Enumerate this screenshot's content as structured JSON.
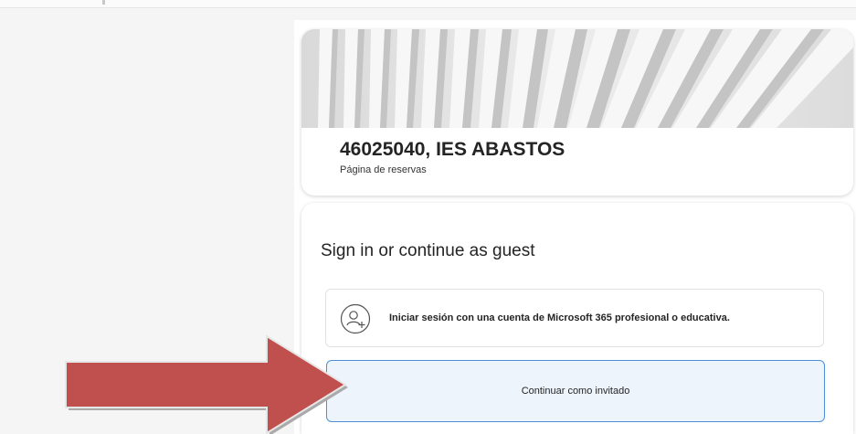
{
  "header": {
    "org_title": "46025040, IES ABASTOS",
    "org_subtitle": "Página de reservas"
  },
  "signin_card": {
    "heading": "Sign in or continue as guest",
    "signin_option_label": "Iniciar sesión con una cuenta de Microsoft 365 profesional o educativa.",
    "guest_option_label": "Continuar como invitado"
  },
  "icons": {
    "signin_option": "person-add-icon",
    "annotation": "red-arrow-icon"
  },
  "colors": {
    "accent_border": "#4f8fd6",
    "guest_background": "#eef4fc",
    "annotation_arrow": "#c0504d"
  }
}
